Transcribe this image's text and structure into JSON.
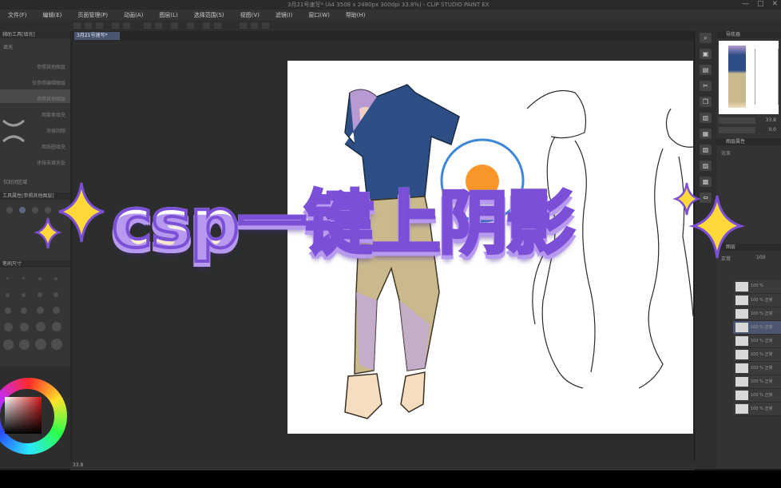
{
  "window": {
    "title": "3月21号速写* (A4 3508 x 2480px 300dpi 33.8%) - CLIP STUDIO PAINT EX",
    "controls": [
      "—",
      "□",
      "✕"
    ]
  },
  "menu": [
    "文件(F)",
    "编辑(E)",
    "页面管理(P)",
    "动画(A)",
    "图层(L)",
    "选择范围(S)",
    "视图(V)",
    "滤镜(I)",
    "窗口(W)",
    "帮助(H)"
  ],
  "document_tab": {
    "label": "3月21号速写*"
  },
  "left_panel": {
    "header": "辅助工具[填充]",
    "sub_header": "填充",
    "items": [
      "参照其他图层",
      "仅参照编辑图层",
      "参照其他图层",
      "用套索填充",
      "涂抹间隙",
      "边缘与间隙",
      "用线圈填充",
      "涂抹未填充处"
    ],
    "option_label": "仅封闭区域",
    "brush_panel_header": "工具属性[参照其他图层]",
    "brush_size_header": "笔刷尺寸"
  },
  "right_panel": {
    "navigator_title": "导航器",
    "zoom_value": "33.8",
    "rotate_value": "0.0",
    "sub_title": "图层属性",
    "effect_label": "效果",
    "layer_title": "图层",
    "layer_mode": "正常",
    "layer_opacity": "100",
    "layers": [
      "100 %",
      "100 % 正常",
      "100 % 正常",
      "100 % 正常",
      "100 % 正常",
      "100 % 正常",
      "100 % 正常",
      "100 % 正常",
      "100 % 正常",
      "100 % 正常"
    ]
  },
  "status": {
    "zoom": "33.8"
  },
  "overlay_title": "csp一键上阴影",
  "colors": {
    "accent": "#7b4fd6",
    "shirt": "#2e4f85",
    "pants": "#c9b98c",
    "hair": "#b79ad4",
    "orange": "#f8962a",
    "ring": "#3f87d8"
  }
}
